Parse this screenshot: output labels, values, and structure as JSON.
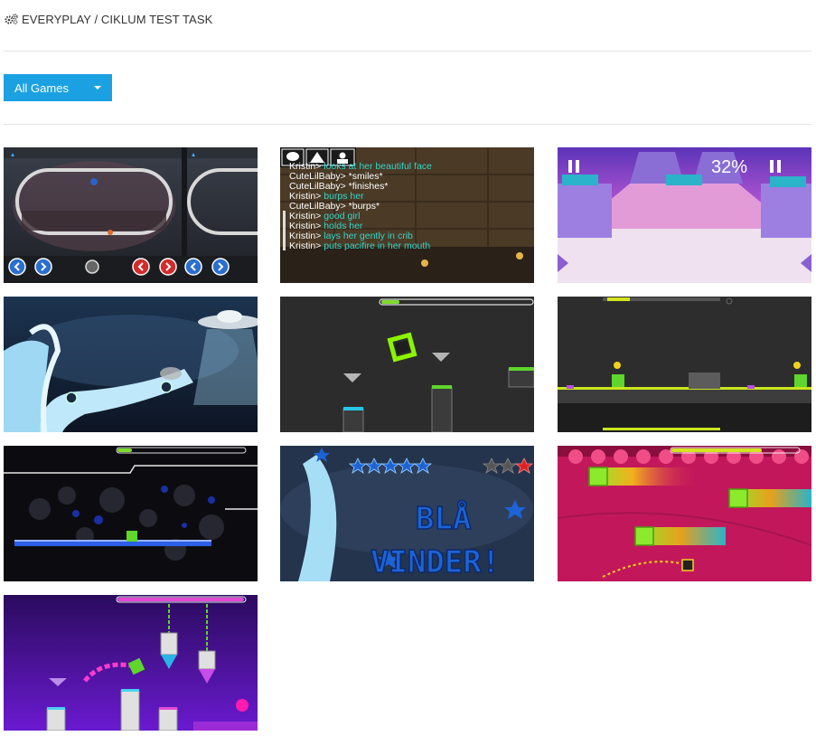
{
  "header": {
    "brand_icon": "cogs-icon",
    "title": "EVERYPLAY / CIKLUM TEST TASK"
  },
  "filter": {
    "selected": "All Games",
    "icon": "caret-down-icon",
    "color": "#1ba1e2"
  },
  "games": [
    {
      "kind": "arena-racing-split-screen"
    },
    {
      "kind": "chat-overlay-game",
      "chat": [
        {
          "name": "Kristin>",
          "msg": "looks at her beautiful face"
        },
        {
          "name": "CuteLilBaby>",
          "msg": "*smiles*"
        },
        {
          "name": "CuteLilBaby>",
          "msg": "*finishes*"
        },
        {
          "name": "Kristin>",
          "msg": "burps her"
        },
        {
          "name": "CuteLilBaby>",
          "msg": "*burps*"
        },
        {
          "name": "Kristin>",
          "msg": "good girl"
        },
        {
          "name": "Kristin>",
          "msg": "holds her"
        },
        {
          "name": "Kristin>",
          "msg": "lays her gently in crib"
        },
        {
          "name": "Kristin>",
          "msg": "puts pacifire in her mouth"
        }
      ]
    },
    {
      "kind": "pastel-runner",
      "progress_text": "32%"
    },
    {
      "kind": "ice-racing-ufo"
    },
    {
      "kind": "geometry-cube-dark"
    },
    {
      "kind": "geometry-cube-yellow"
    },
    {
      "kind": "geometry-neon-bokeh"
    },
    {
      "kind": "winner-screen",
      "banner_line1": "BLÅ",
      "banner_line2": "VINDER!"
    },
    {
      "kind": "geometry-pink-speed"
    },
    {
      "kind": "geometry-purple-chains"
    }
  ]
}
